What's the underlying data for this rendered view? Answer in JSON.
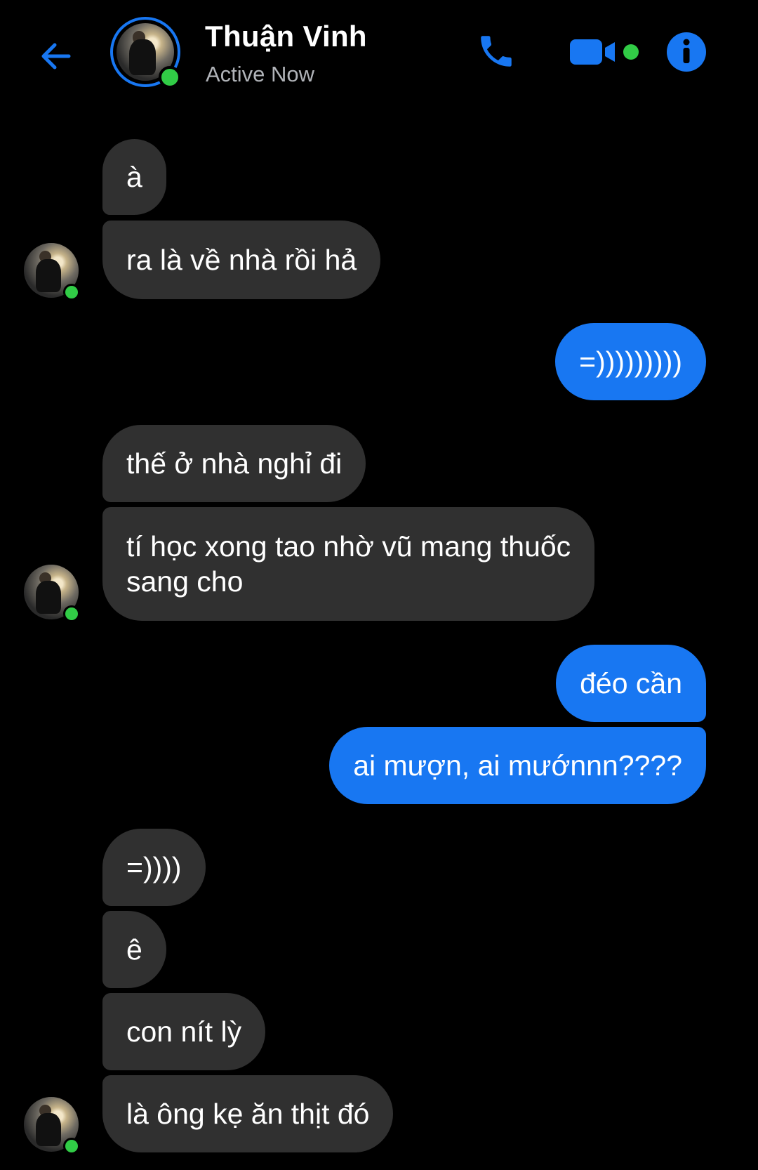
{
  "header": {
    "contact_name": "Thuận Vinh",
    "status": "Active Now",
    "icons": {
      "back": "back-arrow-icon",
      "call": "phone-icon",
      "video": "video-camera-icon",
      "info": "info-icon"
    },
    "accent_color": "#1877f2",
    "online_color": "#31cc46"
  },
  "messages": [
    {
      "from": "them",
      "text": "à"
    },
    {
      "from": "them",
      "text": "ra là về nhà rồi hả"
    },
    {
      "from": "me",
      "text": "=)))))))))"
    },
    {
      "from": "them",
      "text": "thế ở nhà nghỉ đi"
    },
    {
      "from": "them",
      "text": "tí học xong tao nhờ vũ mang thuốc",
      "text2": "sang cho"
    },
    {
      "from": "me",
      "text": "đéo cần"
    },
    {
      "from": "me",
      "text": "ai mượn, ai mướnnn????"
    },
    {
      "from": "them",
      "text": "=))))"
    },
    {
      "from": "them",
      "text": "ê"
    },
    {
      "from": "them",
      "text": "con nít lỳ"
    },
    {
      "from": "them",
      "text": "là ông kẹ ăn thịt đó"
    }
  ],
  "colors": {
    "incoming_bubble": "#303030",
    "outgoing_bubble": "#1877f2",
    "background": "#000000"
  }
}
